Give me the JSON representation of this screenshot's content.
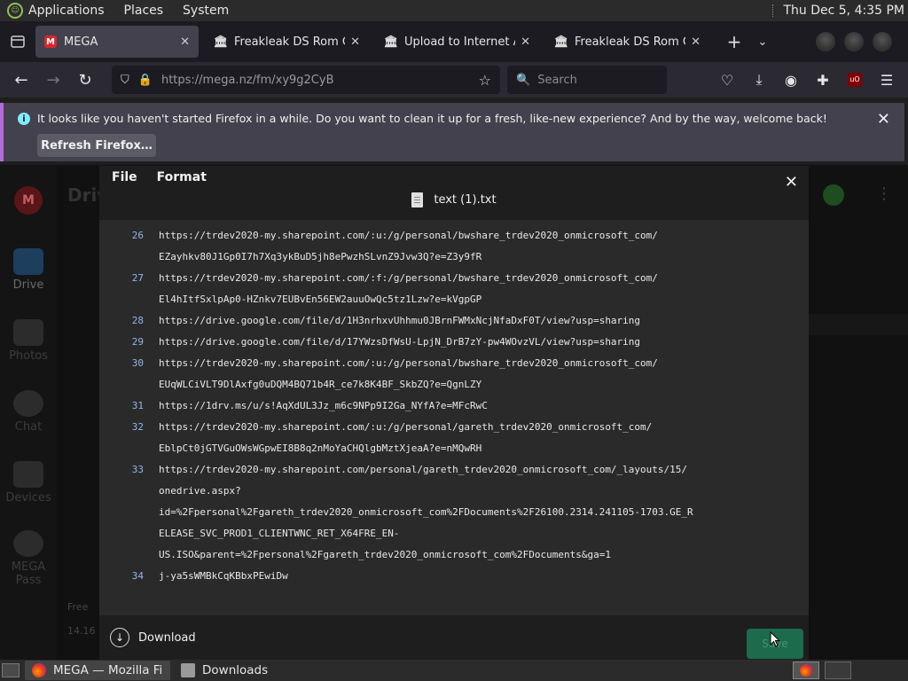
{
  "top_panel": {
    "menus": [
      "Applications",
      "Places",
      "System"
    ],
    "clock": "Thu Dec  5,  4:35 PM"
  },
  "tabs": [
    {
      "title": "MEGA",
      "favicon": "mega-icon",
      "active": true
    },
    {
      "title": "Freakleak DS Rom Col",
      "favicon": "internet-archive-icon",
      "active": false
    },
    {
      "title": "Upload to Internet Arc",
      "favicon": "internet-archive-icon",
      "active": false
    },
    {
      "title": "Freakleak DS Rom Col",
      "favicon": "internet-archive-icon",
      "active": false
    }
  ],
  "navbar": {
    "url": "https://mega.nz/fm/xy9g2CyB",
    "search_placeholder": "Search"
  },
  "notification": {
    "message": "It looks like you haven't started Firefox in a while. Do you want to clean it up for a fresh, like-new experience? And by the way, welcome back!",
    "button": "Refresh Firefox…"
  },
  "mega": {
    "title": "Driv",
    "sidebar": [
      "Drive",
      "Photos",
      "Chat",
      "Devices",
      "MEGA Pass"
    ],
    "free": "Free",
    "storage": "14.16"
  },
  "editor": {
    "menu": [
      "File",
      "Format"
    ],
    "filename": "text (1).txt",
    "lines": [
      {
        "num": "26",
        "text": "https://trdev2020-my.sharepoint.com/:u:/g/personal/bwshare_trdev2020_onmicrosoft_com/"
      },
      {
        "num": "",
        "text": "EZayhkv80J1Gp0I7h7Xq3ykBuD5jh8ePwzhSLvnZ9Jvw3Q?e=Z3y9fR"
      },
      {
        "num": "27",
        "text": "https://trdev2020-my.sharepoint.com/:f:/g/personal/bwshare_trdev2020_onmicrosoft_com/"
      },
      {
        "num": "",
        "text": "El4hItfSxlpAp0-HZnkv7EUBvEn56EW2auuOwQc5tz1Lzw?e=kVgpGP"
      },
      {
        "num": "28",
        "text": "https://drive.google.com/file/d/1H3nrhxvUhhmu0JBrnFWMxNcjNfaDxF0T/view?usp=sharing"
      },
      {
        "num": "29",
        "text": "https://drive.google.com/file/d/17YWzsDfWsU-LpjN_DrB7zY-pw4WOvzVL/view?usp=sharing"
      },
      {
        "num": "30",
        "text": "https://trdev2020-my.sharepoint.com/:u:/g/personal/bwshare_trdev2020_onmicrosoft_com/"
      },
      {
        "num": "",
        "text": "EUqWLCiVLT9DlAxfg0uDQM4BQ71b4R_ce7k8K4BF_SkbZQ?e=QgnLZY"
      },
      {
        "num": "31",
        "text": "https://1drv.ms/u/s!AqXdUL3Jz_m6c9NPp9I2Ga_NYfA?e=MFcRwC"
      },
      {
        "num": "32",
        "text": "https://trdev2020-my.sharepoint.com/:u:/g/personal/gareth_trdev2020_onmicrosoft_com/"
      },
      {
        "num": "",
        "text": "EblpCt0jGTVGuOWsWGpwEI8B8q2nMoYaCHQlgbMztXjeaA?e=nMQwRH"
      },
      {
        "num": "33",
        "text": "https://trdev2020-my.sharepoint.com/personal/gareth_trdev2020_onmicrosoft_com/_layouts/15/"
      },
      {
        "num": "",
        "text": "onedrive.aspx?"
      },
      {
        "num": "",
        "text": "id=%2Fpersonal%2Fgareth_trdev2020_onmicrosoft_com%2FDocuments%2F26100.2314.241105-1703.GE_R"
      },
      {
        "num": "",
        "text": "ELEASE_SVC_PROD1_CLIENTWNC_RET_X64FRE_EN-"
      },
      {
        "num": "",
        "text": "US.ISO&parent=%2Fpersonal%2Fgareth_trdev2020_onmicrosoft_com%2FDocuments&ga=1"
      },
      {
        "num": "34",
        "text": "j-ya5sWMBkCqKBbxPEwiDw"
      }
    ],
    "download_label": "Download",
    "save_label": "Save"
  },
  "taskbar": {
    "tasks": [
      "MEGA — Mozilla Fir…",
      "Downloads"
    ]
  },
  "colors": {
    "notification_accent": "#b46bd8",
    "line_number": "#8fb8e6",
    "save_button": "#1b6b4c"
  }
}
